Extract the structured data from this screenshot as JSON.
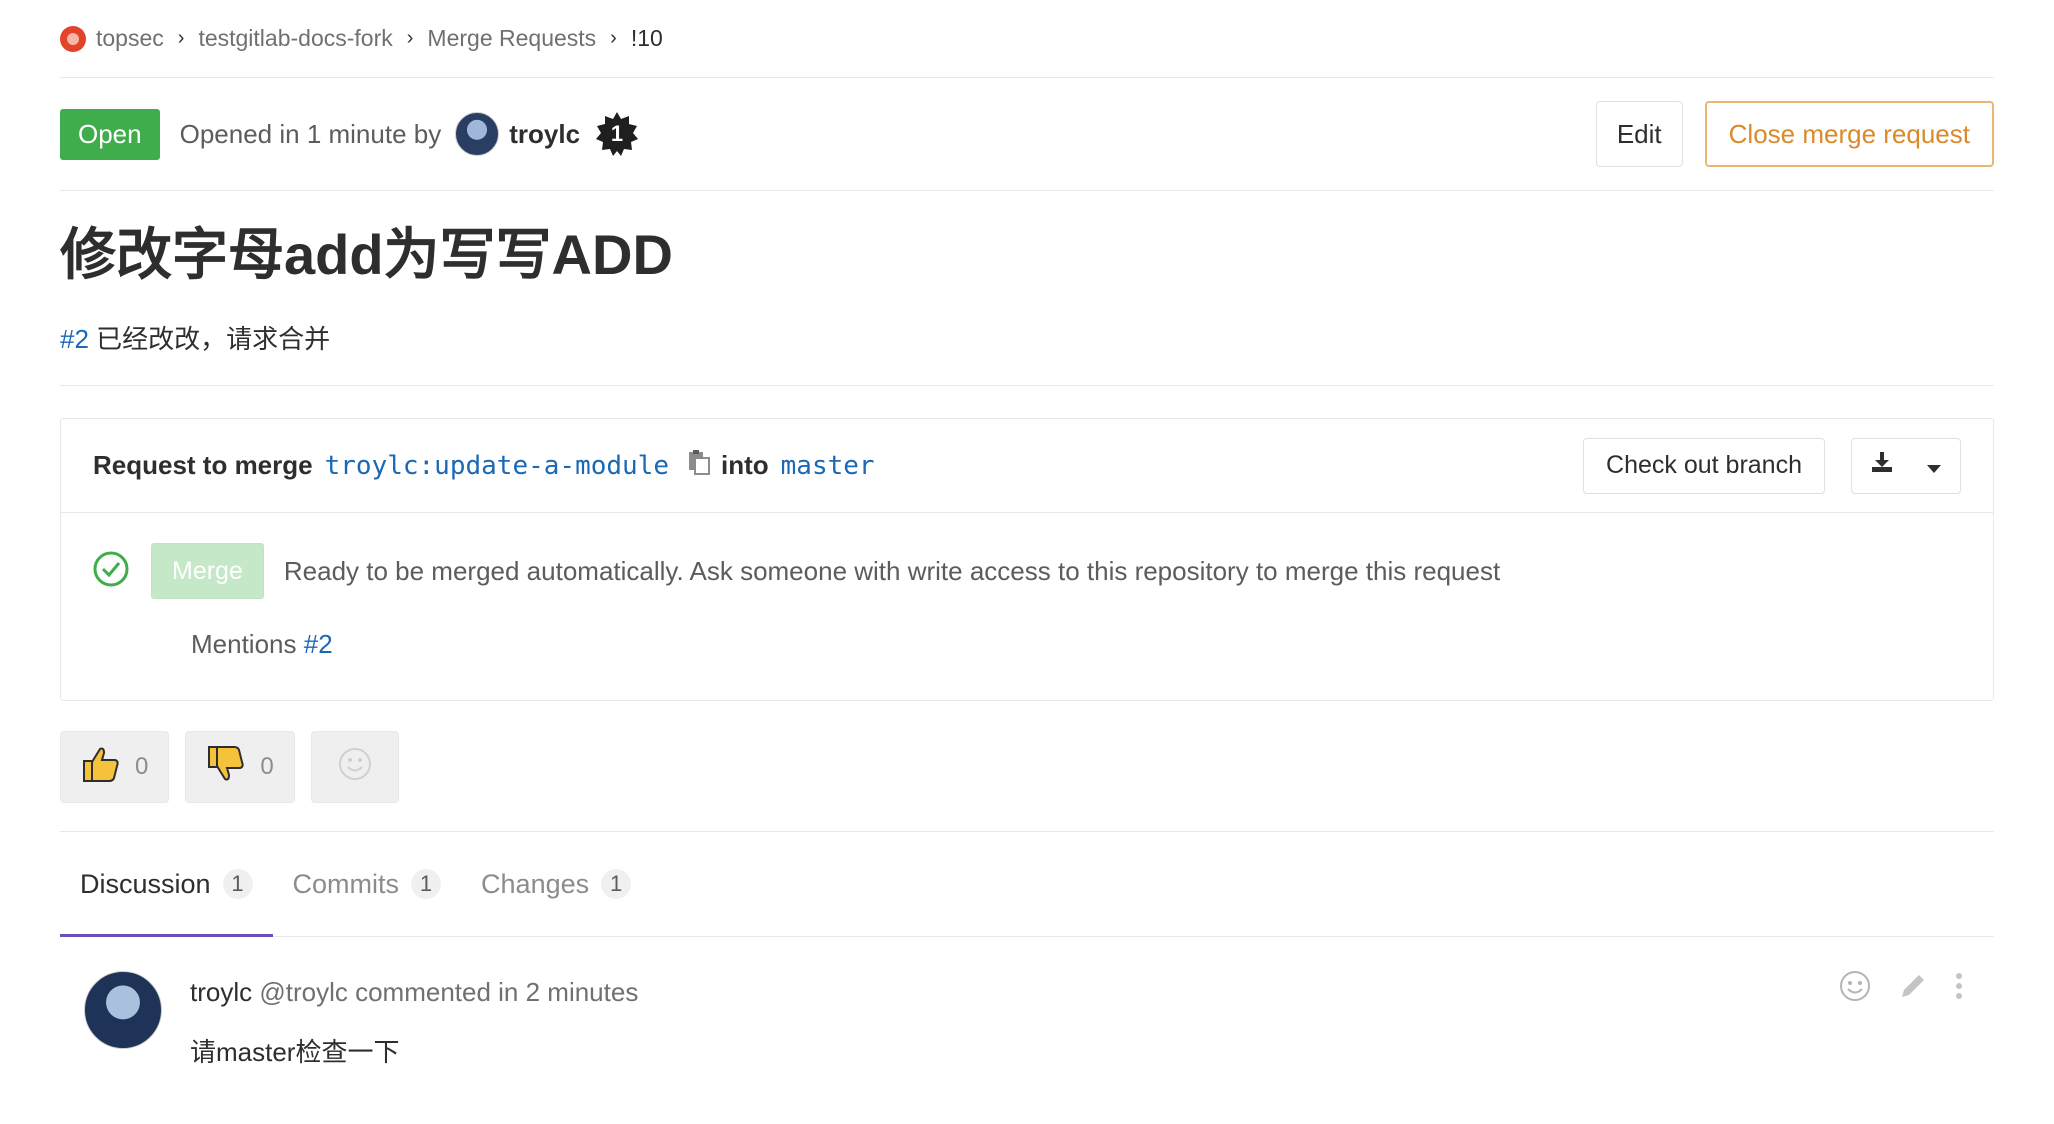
{
  "breadcrumb": {
    "items": [
      "topsec",
      "testgitlab-docs-fork",
      "Merge Requests",
      "!10"
    ]
  },
  "status": {
    "badge": "Open",
    "opened_text": "Opened in 1 minute by",
    "author": "troylc",
    "badge_number": "1",
    "edit_label": "Edit",
    "close_label": "Close merge request"
  },
  "merge_request": {
    "title": "修改字母add为写写ADD",
    "description_ref": "#2",
    "description_text": " 已经改改，请求合并"
  },
  "widget": {
    "request_label": "Request to merge",
    "source_branch": "troylc:update-a-module",
    "into_label": "into",
    "target_branch": "master",
    "checkout_label": "Check out branch",
    "merge_label": "Merge",
    "ready_text": "Ready to be merged automatically. Ask someone with write access to this repository to merge this request",
    "mentions_label": "Mentions",
    "mentions_ref": "#2"
  },
  "awards": {
    "thumbsup_count": "0",
    "thumbsdown_count": "0"
  },
  "tabs": [
    {
      "label": "Discussion",
      "count": "1"
    },
    {
      "label": "Commits",
      "count": "1"
    },
    {
      "label": "Changes",
      "count": "1"
    }
  ],
  "note": {
    "author": "troylc",
    "meta": " @troylc commented in 2 minutes",
    "body": "请master检查一下"
  },
  "colors": {
    "open_green": "#3fad4c",
    "link_blue": "#1b69b6",
    "close_orange": "#d98a2a",
    "tab_active": "#6b4fbb"
  }
}
